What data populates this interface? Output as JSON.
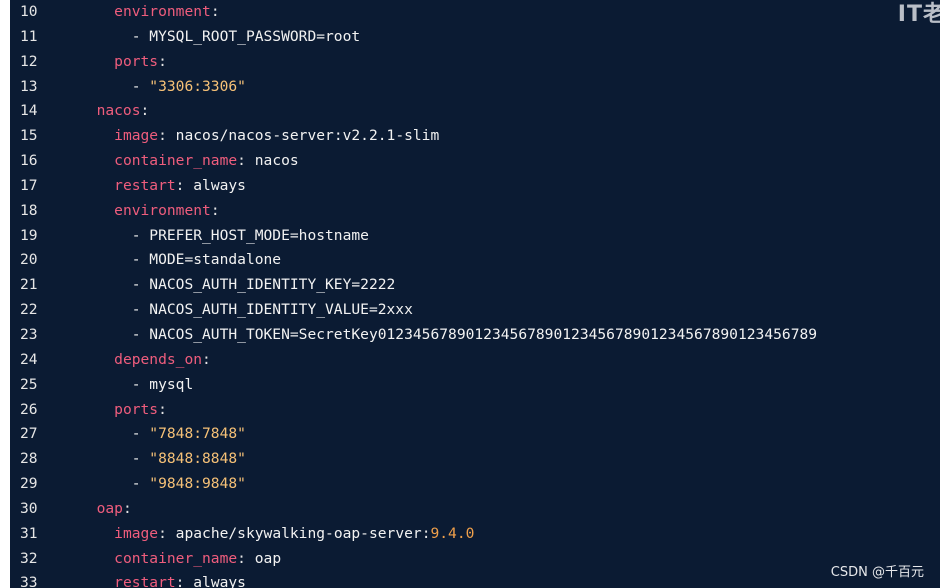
{
  "editor": {
    "lines": [
      {
        "number": "10",
        "tokens": [
          {
            "t": "    ",
            "c": "val"
          },
          {
            "t": "environment",
            "c": "key"
          },
          {
            "t": ":",
            "c": "punc"
          }
        ]
      },
      {
        "number": "11",
        "tokens": [
          {
            "t": "      - ",
            "c": "val"
          },
          {
            "t": "MYSQL_ROOT_PASSWORD=root",
            "c": "val"
          }
        ]
      },
      {
        "number": "12",
        "tokens": [
          {
            "t": "    ",
            "c": "val"
          },
          {
            "t": "ports",
            "c": "key"
          },
          {
            "t": ":",
            "c": "punc"
          }
        ]
      },
      {
        "number": "13",
        "tokens": [
          {
            "t": "      - ",
            "c": "val"
          },
          {
            "t": "\"3306:3306\"",
            "c": "str"
          }
        ]
      },
      {
        "number": "14",
        "tokens": [
          {
            "t": "  ",
            "c": "val"
          },
          {
            "t": "nacos",
            "c": "key"
          },
          {
            "t": ":",
            "c": "punc"
          }
        ]
      },
      {
        "number": "15",
        "tokens": [
          {
            "t": "    ",
            "c": "val"
          },
          {
            "t": "image",
            "c": "key"
          },
          {
            "t": ": ",
            "c": "punc"
          },
          {
            "t": "nacos/nacos-server:v2.2.1-slim",
            "c": "val"
          }
        ]
      },
      {
        "number": "16",
        "tokens": [
          {
            "t": "    ",
            "c": "val"
          },
          {
            "t": "container_name",
            "c": "key"
          },
          {
            "t": ": ",
            "c": "punc"
          },
          {
            "t": "nacos",
            "c": "val"
          }
        ]
      },
      {
        "number": "17",
        "tokens": [
          {
            "t": "    ",
            "c": "val"
          },
          {
            "t": "restart",
            "c": "key"
          },
          {
            "t": ": ",
            "c": "punc"
          },
          {
            "t": "always",
            "c": "val"
          }
        ]
      },
      {
        "number": "18",
        "tokens": [
          {
            "t": "    ",
            "c": "val"
          },
          {
            "t": "environment",
            "c": "key"
          },
          {
            "t": ":",
            "c": "punc"
          }
        ]
      },
      {
        "number": "19",
        "tokens": [
          {
            "t": "      - ",
            "c": "val"
          },
          {
            "t": "PREFER_HOST_MODE=hostname",
            "c": "val"
          }
        ]
      },
      {
        "number": "20",
        "tokens": [
          {
            "t": "      - ",
            "c": "val"
          },
          {
            "t": "MODE=standalone",
            "c": "val"
          }
        ]
      },
      {
        "number": "21",
        "tokens": [
          {
            "t": "      - ",
            "c": "val"
          },
          {
            "t": "NACOS_AUTH_IDENTITY_KEY=2222",
            "c": "val"
          }
        ]
      },
      {
        "number": "22",
        "tokens": [
          {
            "t": "      - ",
            "c": "val"
          },
          {
            "t": "NACOS_AUTH_IDENTITY_VALUE=2xxx",
            "c": "val"
          }
        ]
      },
      {
        "number": "23",
        "tokens": [
          {
            "t": "      - ",
            "c": "val"
          },
          {
            "t": "NACOS_AUTH_TOKEN=SecretKey01234567890123456789012345678901234567890123456789",
            "c": "val"
          }
        ]
      },
      {
        "number": "24",
        "tokens": [
          {
            "t": "    ",
            "c": "val"
          },
          {
            "t": "depends_on",
            "c": "key"
          },
          {
            "t": ":",
            "c": "punc"
          }
        ]
      },
      {
        "number": "25",
        "tokens": [
          {
            "t": "      - ",
            "c": "val"
          },
          {
            "t": "mysql",
            "c": "val"
          }
        ]
      },
      {
        "number": "26",
        "tokens": [
          {
            "t": "    ",
            "c": "val"
          },
          {
            "t": "ports",
            "c": "key"
          },
          {
            "t": ":",
            "c": "punc"
          }
        ]
      },
      {
        "number": "27",
        "tokens": [
          {
            "t": "      - ",
            "c": "val"
          },
          {
            "t": "\"7848:7848\"",
            "c": "str"
          }
        ]
      },
      {
        "number": "28",
        "tokens": [
          {
            "t": "      - ",
            "c": "val"
          },
          {
            "t": "\"8848:8848\"",
            "c": "str"
          }
        ]
      },
      {
        "number": "29",
        "tokens": [
          {
            "t": "      - ",
            "c": "val"
          },
          {
            "t": "\"9848:9848\"",
            "c": "str"
          }
        ]
      },
      {
        "number": "30",
        "tokens": [
          {
            "t": "  ",
            "c": "val"
          },
          {
            "t": "oap",
            "c": "key"
          },
          {
            "t": ":",
            "c": "punc"
          }
        ]
      },
      {
        "number": "31",
        "tokens": [
          {
            "t": "    ",
            "c": "val"
          },
          {
            "t": "image",
            "c": "key"
          },
          {
            "t": ": ",
            "c": "punc"
          },
          {
            "t": "apache/skywalking-oap-server",
            "c": "val"
          },
          {
            "t": ":",
            "c": "punc"
          },
          {
            "t": "9.4.0",
            "c": "num"
          }
        ]
      },
      {
        "number": "32",
        "tokens": [
          {
            "t": "    ",
            "c": "val"
          },
          {
            "t": "container_name",
            "c": "key"
          },
          {
            "t": ": ",
            "c": "punc"
          },
          {
            "t": "oap",
            "c": "val"
          }
        ]
      },
      {
        "number": "33",
        "tokens": [
          {
            "t": "    ",
            "c": "val"
          },
          {
            "t": "restart",
            "c": "key"
          },
          {
            "t": ": ",
            "c": "punc"
          },
          {
            "t": "always",
            "c": "val"
          }
        ]
      }
    ]
  },
  "watermarks": {
    "top_right": "IT老",
    "bottom_right": "CSDN @千百元"
  },
  "colors": {
    "background": "#0b1b33",
    "key": "#ef5d7d",
    "string": "#f6c177",
    "number": "#f0a04b",
    "text": "#f2f2f2"
  }
}
